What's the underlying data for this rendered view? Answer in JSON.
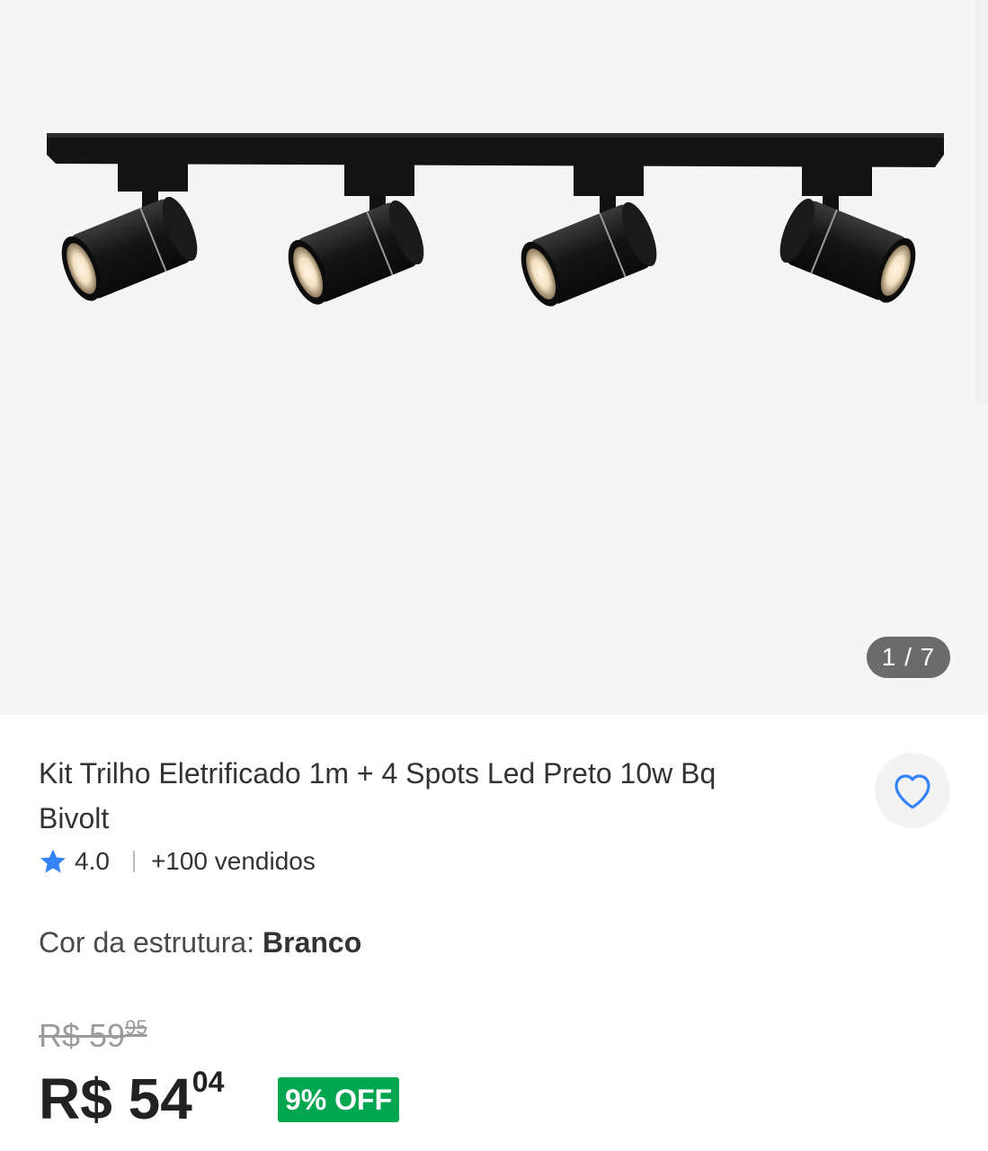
{
  "gallery": {
    "counter": "1 / 7",
    "image_alt": "Trilho com 4 spots pretos"
  },
  "product": {
    "title": "Kit Trilho Eletrificado 1m + 4 Spots Led Preto 10w Bq Bivolt",
    "rating": "4.0",
    "sold": "+100 vendidos"
  },
  "variant": {
    "label": "Cor da estrutura:",
    "value": "Branco"
  },
  "pricing": {
    "old_price_main": "R$ 59",
    "old_price_cents": "95",
    "price_main": "R$ 54",
    "price_cents": "04",
    "discount": "9% OFF"
  },
  "colors": {
    "star": "#3483fa",
    "favorite": "#3483fa",
    "discount_bg": "#00a650"
  },
  "icons": {
    "star": "star-icon",
    "favorite": "heart-outline-icon"
  }
}
